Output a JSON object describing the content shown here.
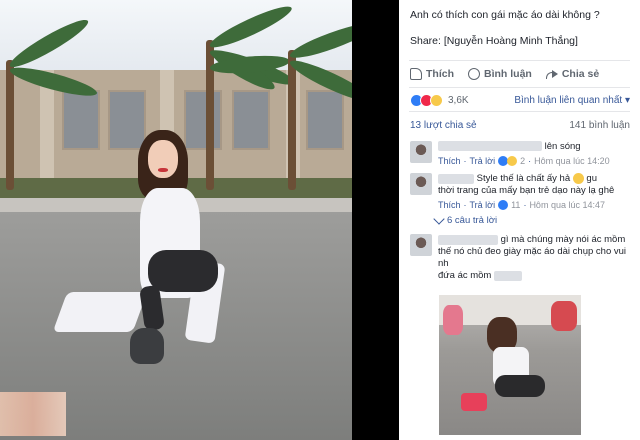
{
  "post": {
    "text": "Anh có thích con gái mặc áo dài không ?",
    "share_credit": "Share: [Nguyễn Hoàng Minh Thắng]"
  },
  "actions": {
    "like_label": "Thích",
    "comment_label": "Bình luận",
    "share_label": "Chia sẻ"
  },
  "reactions": {
    "count": "3,6K",
    "sort_label": "Bình luận liên quan nhất"
  },
  "stats": {
    "shares": "13 lượt chia sẻ",
    "comments": "141 bình luận"
  },
  "comments": [
    {
      "text": "lên sóng",
      "like": "Thích",
      "reply": "Trả lời",
      "reactions": "2",
      "time": "Hôm qua lúc 14:20"
    },
    {
      "text_line1": "Style thế là chất ấy hả",
      "text_line1_end": "gu",
      "text_line2": "thời trang của mấy bạn trẻ dạo này lạ ghê",
      "like": "Thích",
      "reply": "Trả lời",
      "reactions": "11",
      "time": "Hôm qua lúc 14:47",
      "replies": "6 câu trả lời"
    },
    {
      "text_line1": "gì mà chúng mày nói ác mồm",
      "text_line2": "thế nó chủ đeo giày mặc áo dài chụp cho vui nh",
      "text_line3": "đứa ác mồm"
    }
  ],
  "colors": {
    "link": "#385898",
    "muted": "#606770",
    "like_blue": "#2f7df6",
    "love_red": "#f0284a",
    "haha_yellow": "#f7c94a"
  }
}
